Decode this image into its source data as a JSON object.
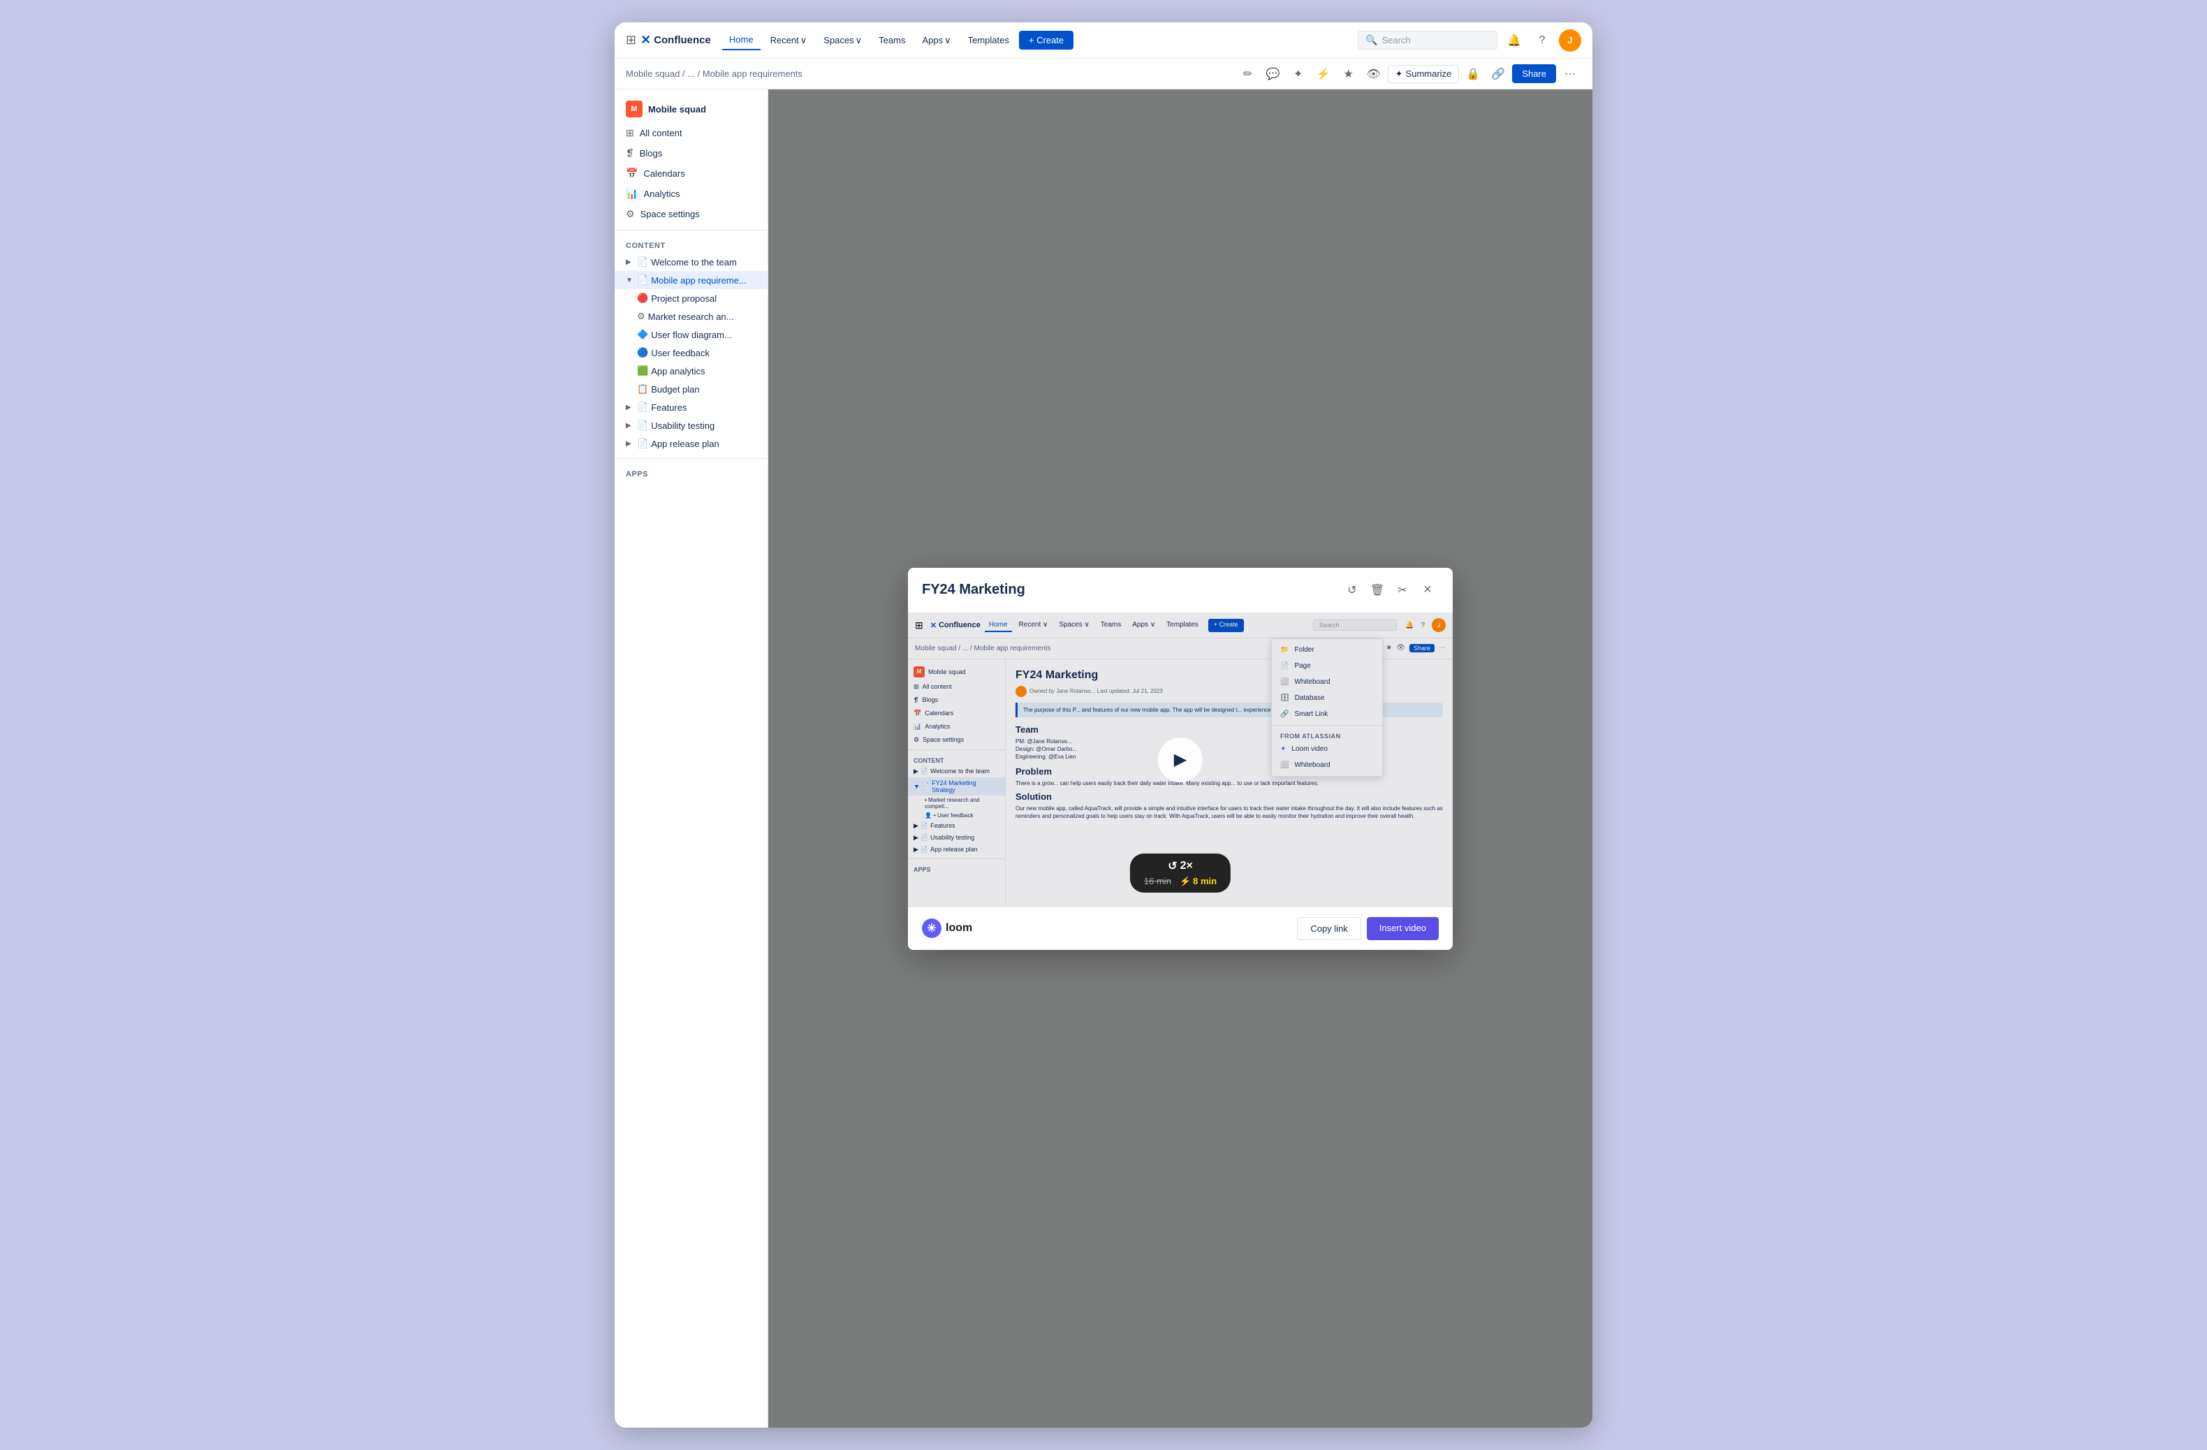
{
  "browser": {
    "bg_color": "#c5c8e8"
  },
  "top_nav": {
    "logo_text": "Confluence",
    "home_label": "Home",
    "recent_label": "Recent",
    "spaces_label": "Spaces",
    "teams_label": "Teams",
    "apps_label": "Apps",
    "templates_label": "Templates",
    "create_label": "+ Create",
    "search_placeholder": "Search"
  },
  "page_toolbar": {
    "breadcrumb": "Mobile squad / ... / Mobile app requirements",
    "summarize_label": "Summarize",
    "share_label": "Share"
  },
  "sidebar": {
    "space_name": "Mobile squad",
    "items": [
      {
        "label": "All content",
        "icon": "⊞"
      },
      {
        "label": "Blogs",
        "icon": "❡"
      },
      {
        "label": "Calendars",
        "icon": "📅"
      },
      {
        "label": "Analytics",
        "icon": "📊"
      },
      {
        "label": "Space settings",
        "icon": "⚙"
      }
    ],
    "content_section": "CONTENT",
    "apps_section": "APPS",
    "tree_items": [
      {
        "label": "Welcome to the team",
        "indent": 0,
        "expanded": false
      },
      {
        "label": "Mobile app requireme...",
        "indent": 0,
        "expanded": true,
        "active": true
      },
      {
        "label": "Project proposal",
        "indent": 1
      },
      {
        "label": "Market research an...",
        "indent": 1
      },
      {
        "label": "User flow diagram...",
        "indent": 1
      },
      {
        "label": "User feedback",
        "indent": 1
      },
      {
        "label": "App analytics",
        "indent": 1
      },
      {
        "label": "Budget plan",
        "indent": 1
      },
      {
        "label": "Features",
        "indent": 0,
        "expanded": false
      },
      {
        "label": "Usability testing",
        "indent": 0,
        "expanded": false
      },
      {
        "label": "App release plan",
        "indent": 0,
        "expanded": false
      }
    ]
  },
  "modal": {
    "title": "FY24 Marketing",
    "video_preview": {
      "inner_page_title": "FY24 Marketing",
      "inner_meta": "Owned by Jane Rotanso... Last updated: Jul 21, 2023",
      "inner_breadcrumb": "Mobile squad / ... / Mobile app requirements",
      "play_icon": "▶",
      "speed_label": "2×",
      "time_original": "16 min",
      "lightning_icon": "⚡",
      "time_fast": "8 min",
      "inner_nav": {
        "logo": "Confluence",
        "home": "Home",
        "recent": "Recent ∨",
        "spaces": "Spaces ∨",
        "teams": "Teams",
        "apps": "Apps ∨",
        "templates": "Templates",
        "create": "+ Create",
        "search": "Search"
      },
      "dropdown_items": [
        {
          "label": "Folder",
          "icon": "📁"
        },
        {
          "label": "Page",
          "icon": "📄"
        },
        {
          "label": "Whiteboard",
          "icon": "⬜"
        },
        {
          "label": "Database",
          "icon": "🗄"
        },
        {
          "label": "Smart Link",
          "icon": "🔗"
        }
      ],
      "dropdown_section": "FROM ATLASSIAN",
      "dropdown_atlassian_items": [
        {
          "label": "Loom video",
          "icon": "✦"
        },
        {
          "label": "Whiteboard",
          "icon": "⬜"
        }
      ],
      "inner_sidebar": {
        "space": "Mobile squad",
        "items": [
          "All content",
          "Blogs",
          "Calendars",
          "Analytics",
          "Space settings"
        ],
        "section": "CONTENT",
        "tree": [
          "Welcome to the team",
          "FY24 Marketing Strategy",
          "Market research and competi...",
          "User feedback",
          "Features",
          "Usability testing",
          "App release plan"
        ]
      },
      "inner_content": {
        "team_label": "Team",
        "team_items": [
          "PM: @Jane Rotanso...",
          "Design: @Omar Darbo...",
          "Engineering: @Eva Lien"
        ],
        "problem_label": "Problem",
        "problem_text": "There is a grow... can help users easily track their daily water intake. Many existing app... to use or lack important features.",
        "solution_label": "Solution",
        "solution_text": "Our new mobile app, called AquaTrack, will provide a simple and intuitive interface for users to track their water intake throughout the day. It will also include features such as reminders and personalized goals to help users stay on track. With AquaTrack, users will be able to easily monitor their hydration and improve their overall health.",
        "info_text": "The purpose of this P... and features of our new mobile app. The app will be designed t... experience, for both iOS and Android."
      }
    },
    "footer": {
      "loom_logo": "loom",
      "copy_link_label": "Copy link",
      "insert_video_label": "Insert video"
    },
    "actions": {
      "undo_icon": "↺",
      "delete_icon": "🗑",
      "cut_icon": "✂",
      "close_icon": "×"
    }
  }
}
